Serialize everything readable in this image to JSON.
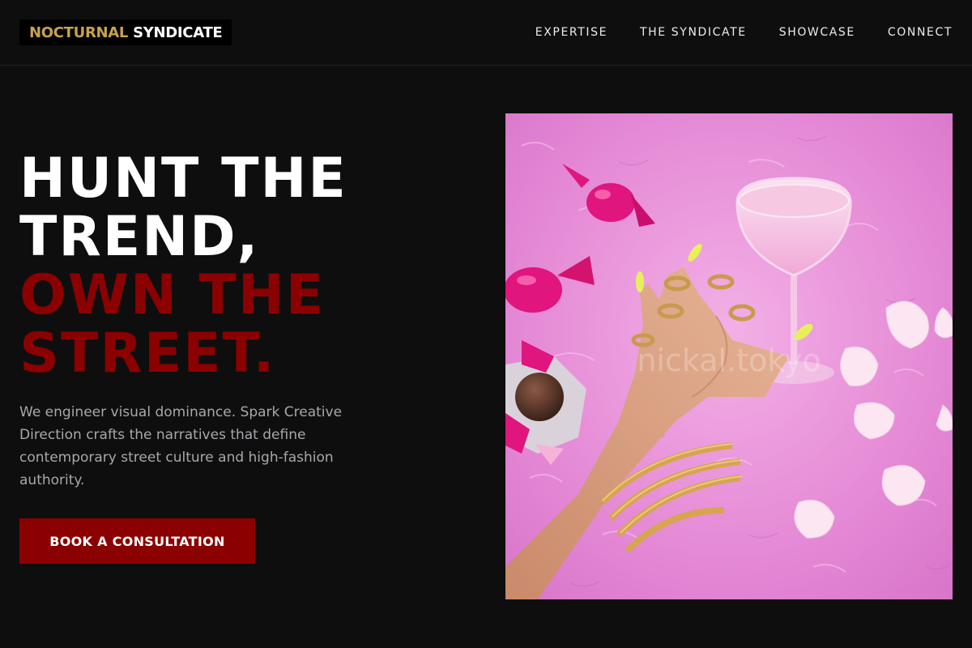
{
  "brand": {
    "name_part1": "NOCTURNAL",
    "name_part2": "SYNDICATE",
    "accent_color": "#c9a24c"
  },
  "nav": {
    "items": [
      {
        "label": "EXPERTISE"
      },
      {
        "label": "THE SYNDICATE"
      },
      {
        "label": "SHOWCASE"
      },
      {
        "label": "CONNECT"
      }
    ]
  },
  "hero": {
    "headline_line1": "HUNT THE",
    "headline_line2": "TREND,",
    "headline_line3": "OWN THE",
    "headline_line4": "STREET.",
    "subtext": "We engineer visual dominance. Spark Creative Direction crafts the narratives that define contemporary street culture and high-fashion authority.",
    "cta_label": "BOOK A CONSULTATION",
    "accent_color": "#8b0000",
    "image_watermark": "nickal.tokyo"
  },
  "colors": {
    "background": "#0e0e0f",
    "headline_white": "#ffffff",
    "headline_red": "#8b0000",
    "body_text": "#a8a8ad"
  }
}
